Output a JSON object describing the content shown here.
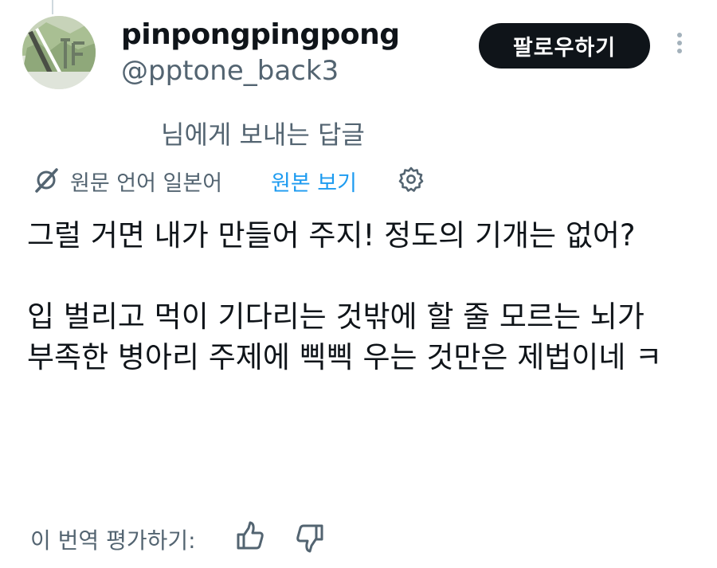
{
  "author": {
    "display_name": "pinpongpingpong",
    "handle": "@pptone_back3"
  },
  "actions": {
    "follow_label": "팔로우하기",
    "more_icon": "more-vertical-icon"
  },
  "reply_context": {
    "text": "님에게 보내는 답글"
  },
  "translation": {
    "translated_from": "원문 언어 일본어",
    "show_original": "원본 보기",
    "link_color": "#1d9bf0",
    "settings_icon": "gear-icon",
    "translate_icon": "translate-slash-icon"
  },
  "tweet": {
    "paragraph_1": "그럴 거면 내가 만들어 주지! 정도의 기개는 없어?",
    "paragraph_2": "입 벌리고 먹이 기다리는 것밖에 할 줄 모르는 뇌가 부족한 병아리 주제에 삑삑 우는 것만은 제법이네 ㅋ"
  },
  "rating": {
    "label": "이 번역 평가하기:",
    "thumb_up_icon": "thumbs-up-icon",
    "thumb_down_icon": "thumbs-down-icon"
  }
}
